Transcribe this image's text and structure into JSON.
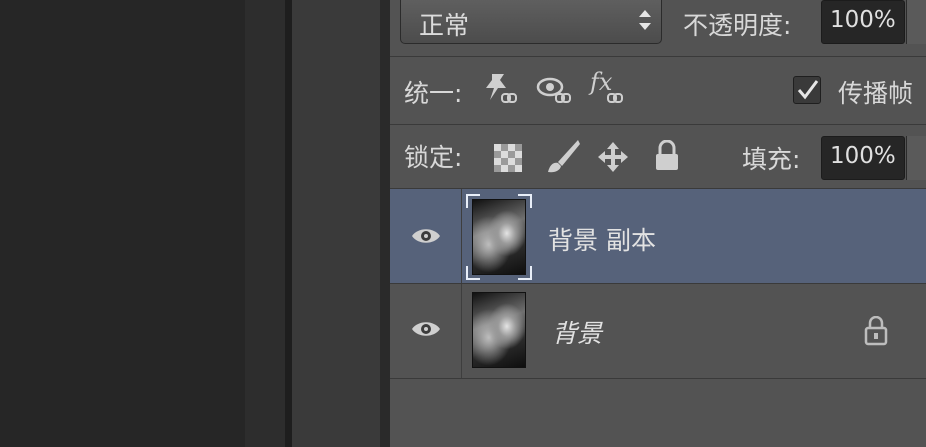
{
  "layers_panel": {
    "blend_mode": "正常",
    "opacity_label": "不透明度:",
    "opacity_value": "100%",
    "unify_label": "统一:",
    "propagate_label": "传播帧",
    "propagate_checked": true,
    "lock_label": "锁定:",
    "fill_label": "填充:",
    "fill_value": "100%",
    "layers": [
      {
        "name": "背景 副本",
        "visible": true,
        "selected": true,
        "locked": false
      },
      {
        "name": "背景",
        "visible": true,
        "selected": false,
        "locked": true
      }
    ]
  },
  "colors": {
    "panel_bg": "#535353",
    "selected_row": "#56627a",
    "canvas_bg": "#262626"
  },
  "icons": [
    "unify-position-icon",
    "unify-visibility-icon",
    "unify-style-icon",
    "lock-transparent-pixels-icon",
    "lock-image-pixels-icon",
    "lock-position-icon",
    "lock-all-icon",
    "eye-icon",
    "lock-icon"
  ]
}
